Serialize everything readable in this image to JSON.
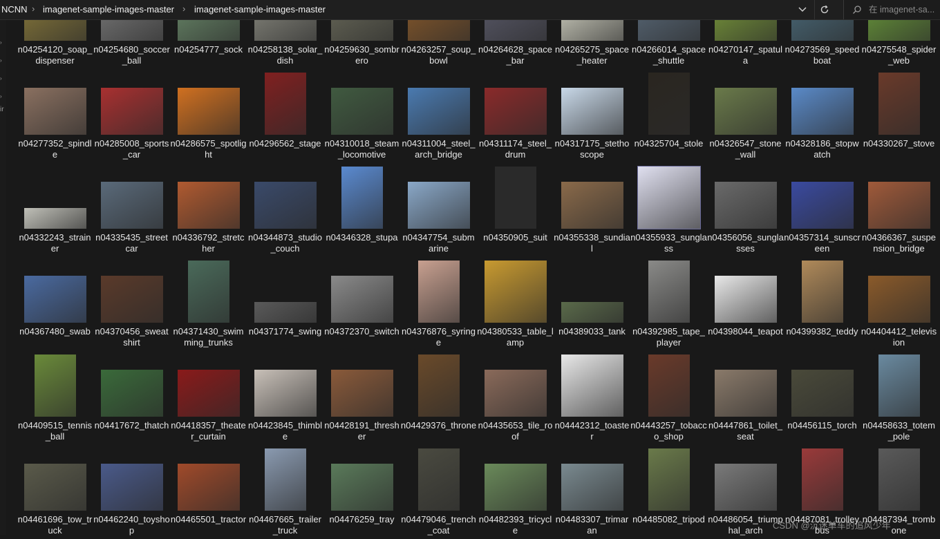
{
  "breadcrumb": {
    "root": "NCNN",
    "folder1": "imagenet-sample-images-master",
    "folder2": "imagenet-sample-images-master"
  },
  "search": {
    "placeholder": "在 imagenet-sa..."
  },
  "watermark": "CSDN @沉迷单车的追风少年",
  "icons": {
    "dropdown": "chevron-down-icon",
    "refresh": "refresh-icon",
    "search": "search-icon"
  },
  "files": [
    {
      "name": "n04254120_soap_dispenser",
      "color": "#8a7a3a",
      "thumb": "wide"
    },
    {
      "name": "n04254680_soccer_ball",
      "color": "#7a7a7a",
      "thumb": "wide"
    },
    {
      "name": "n04254777_sock",
      "color": "#6a8a6a",
      "thumb": "wide"
    },
    {
      "name": "n04258138_solar_dish",
      "color": "#8a8a80",
      "thumb": "wide"
    },
    {
      "name": "n04259630_sombrero",
      "color": "#6a6a5a",
      "thumb": "wide"
    },
    {
      "name": "n04263257_soup_bowl",
      "color": "#8a5a2a",
      "thumb": "wide"
    },
    {
      "name": "n04264628_space_bar",
      "color": "#5a5a6a",
      "thumb": "wide"
    },
    {
      "name": "n04265275_space_heater",
      "color": "#d8d8c8",
      "thumb": "wide"
    },
    {
      "name": "n04266014_space_shuttle",
      "color": "#5a6a7a",
      "thumb": "wide"
    },
    {
      "name": "n04270147_spatula",
      "color": "#7a9a3a",
      "thumb": "wide"
    },
    {
      "name": "n04273569_speedboat",
      "color": "#4a6a7a",
      "thumb": "wide"
    },
    {
      "name": "n04275548_spider_web",
      "color": "#6a9a3a",
      "thumb": "wide"
    },
    {
      "name": "n04277352_spindle",
      "color": "#8a7060",
      "thumb": "wide"
    },
    {
      "name": "n04285008_sports_car",
      "color": "#a83030",
      "thumb": "wide"
    },
    {
      "name": "n04286575_spotlight",
      "color": "#d07020",
      "thumb": "wide"
    },
    {
      "name": "n04296562_stage",
      "color": "#802020",
      "thumb": "tall"
    },
    {
      "name": "n04310018_steam_locomotive",
      "color": "#405a40",
      "thumb": "wide"
    },
    {
      "name": "n04311004_steel_arch_bridge",
      "color": "#4a7ab0",
      "thumb": "wide"
    },
    {
      "name": "n04311174_steel_drum",
      "color": "#8a2a2a",
      "thumb": "wide"
    },
    {
      "name": "n04317175_stethoscope",
      "color": "#c8d8e8",
      "thumb": "wide"
    },
    {
      "name": "n04325704_stole",
      "color": "#2a2620",
      "thumb": "tall"
    },
    {
      "name": "n04326547_stone_wall",
      "color": "#6a7a4a",
      "thumb": "wide"
    },
    {
      "name": "n04328186_stopwatch",
      "color": "#5a8ac8",
      "thumb": "wide"
    },
    {
      "name": "n04330267_stove",
      "color": "#6a3a2a",
      "thumb": "tall"
    },
    {
      "name": "n04332243_strainer",
      "color": "#c0c0b8",
      "thumb": "short"
    },
    {
      "name": "n04335435_streetcar",
      "color": "#5a6a7a",
      "thumb": "wide"
    },
    {
      "name": "n04336792_stretcher",
      "color": "#b05a30",
      "thumb": "wide"
    },
    {
      "name": "n04344873_studio_couch",
      "color": "#3a4a6a",
      "thumb": "wide"
    },
    {
      "name": "n04346328_stupa",
      "color": "#5a8ad0",
      "thumb": "tall"
    },
    {
      "name": "n04347754_submarine",
      "color": "#8aa8c8",
      "thumb": "wide"
    },
    {
      "name": "n04350905_suit",
      "color": "#2a2a2a",
      "thumb": "tall"
    },
    {
      "name": "n04355338_sundial",
      "color": "#8a6a4a",
      "thumb": "wide"
    },
    {
      "name": "n04355933_sunglass",
      "color": "#e0e0f0",
      "thumb": "square"
    },
    {
      "name": "n04356056_sunglasses",
      "color": "#6a6a6a",
      "thumb": "wide"
    },
    {
      "name": "n04357314_sunscreen",
      "color": "#3a4aa0",
      "thumb": "wide"
    },
    {
      "name": "n04366367_suspension_bridge",
      "color": "#a05a3a",
      "thumb": "wide"
    },
    {
      "name": "n04367480_swab",
      "color": "#4a6aa0",
      "thumb": "wide"
    },
    {
      "name": "n04370456_sweatshirt",
      "color": "#5a3a2a",
      "thumb": "wide"
    },
    {
      "name": "n04371430_swimming_trunks",
      "color": "#4a6a5a",
      "thumb": "tall"
    },
    {
      "name": "n04371774_swing",
      "color": "#5a5a5a",
      "thumb": "short"
    },
    {
      "name": "n04372370_switch",
      "color": "#8a8a8a",
      "thumb": "wide"
    },
    {
      "name": "n04376876_syringe",
      "color": "#c8a090",
      "thumb": "tall"
    },
    {
      "name": "n04380533_table_lamp",
      "color": "#c89a30",
      "thumb": "square"
    },
    {
      "name": "n04389033_tank",
      "color": "#5a6a4a",
      "thumb": "short"
    },
    {
      "name": "n04392985_tape_player",
      "color": "#8a8a88",
      "thumb": "tall"
    },
    {
      "name": "n04398044_teapot",
      "color": "#e8e8e8",
      "thumb": "wide"
    },
    {
      "name": "n04399382_teddy",
      "color": "#b08a5a",
      "thumb": "tall"
    },
    {
      "name": "n04404412_television",
      "color": "#8a5a2a",
      "thumb": "wide"
    },
    {
      "name": "n04409515_tennis_ball",
      "color": "#6a8a3a",
      "thumb": "tall"
    },
    {
      "name": "n04417672_thatch",
      "color": "#3a6a3a",
      "thumb": "wide"
    },
    {
      "name": "n04418357_theater_curtain",
      "color": "#8a1a1a",
      "thumb": "wide"
    },
    {
      "name": "n04423845_thimble",
      "color": "#c8c0b8",
      "thumb": "wide"
    },
    {
      "name": "n04428191_thresher",
      "color": "#8a5a3a",
      "thumb": "wide"
    },
    {
      "name": "n04429376_throne",
      "color": "#6a4a2a",
      "thumb": "tall"
    },
    {
      "name": "n04435653_tile_roof",
      "color": "#8a6a5a",
      "thumb": "wide"
    },
    {
      "name": "n04442312_toaster",
      "color": "#e8e8e8",
      "thumb": "square"
    },
    {
      "name": "n04443257_tobacco_shop",
      "color": "#6a3a2a",
      "thumb": "tall"
    },
    {
      "name": "n04447861_toilet_seat",
      "color": "#8a7a6a",
      "thumb": "wide"
    },
    {
      "name": "n04456115_torch",
      "color": "#4a4a3a",
      "thumb": "wide"
    },
    {
      "name": "n04458633_totem_pole",
      "color": "#6a8aa0",
      "thumb": "tall"
    },
    {
      "name": "n04461696_tow_truck",
      "color": "#5a5a4a",
      "thumb": "wide"
    },
    {
      "name": "n04462240_toyshop",
      "color": "#4a5a8a",
      "thumb": "wide"
    },
    {
      "name": "n04465501_tractor",
      "color": "#a04a2a",
      "thumb": "wide"
    },
    {
      "name": "n04467665_trailer_truck",
      "color": "#8a9ab0",
      "thumb": "tall"
    },
    {
      "name": "n04476259_tray",
      "color": "#5a7a5a",
      "thumb": "wide"
    },
    {
      "name": "n04479046_trench_coat",
      "color": "#4a4a40",
      "thumb": "tall"
    },
    {
      "name": "n04482393_tricycle",
      "color": "#6a8a5a",
      "thumb": "wide"
    },
    {
      "name": "n04483307_trimaran",
      "color": "#7a8a90",
      "thumb": "wide"
    },
    {
      "name": "n04485082_tripod",
      "color": "#6a7a4a",
      "thumb": "tall"
    },
    {
      "name": "n04486054_triumphal_arch",
      "color": "#7a7a7a",
      "thumb": "wide"
    },
    {
      "name": "n04487081_trolleybus",
      "color": "#9a3a3a",
      "thumb": "tall"
    },
    {
      "name": "n04487394_trombone",
      "color": "#5a5a5a",
      "thumb": "tall"
    }
  ]
}
